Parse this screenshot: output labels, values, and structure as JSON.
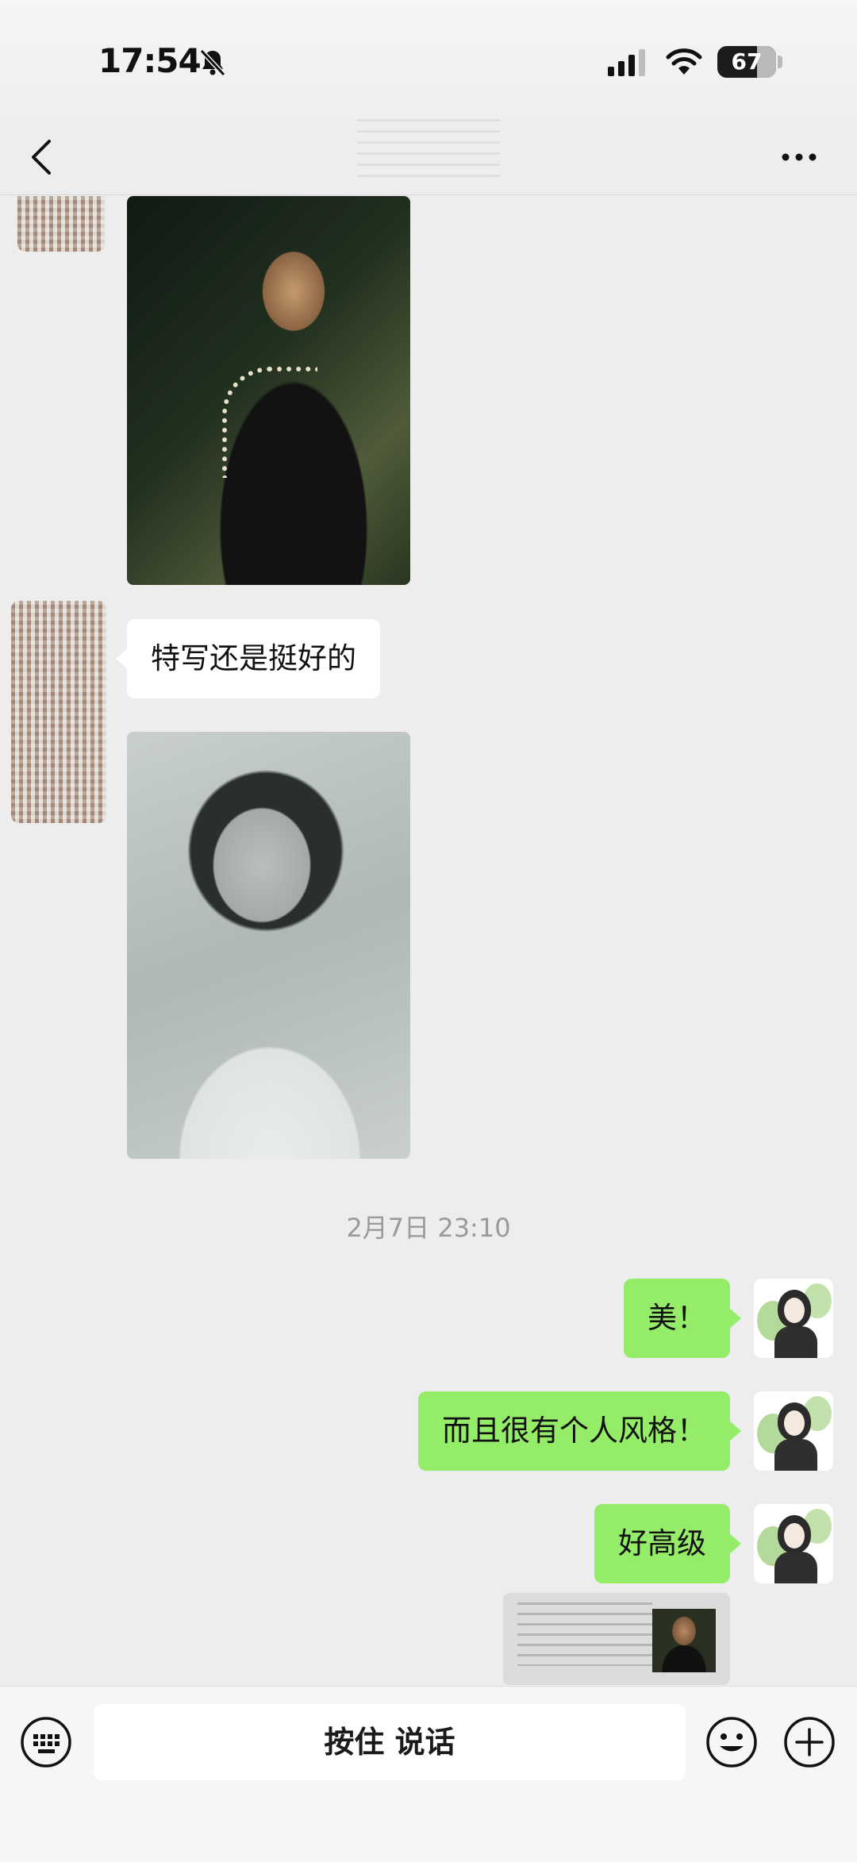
{
  "status_bar": {
    "time": "17:54",
    "battery_level": "67",
    "icons": [
      "bell-slash-icon",
      "signal-icon",
      "wifi-icon",
      "battery-icon"
    ]
  },
  "nav": {
    "back_icon": "chevron-left-icon",
    "more_icon": "ellipsis-icon"
  },
  "messages": [
    {
      "side": "left",
      "type": "image",
      "content": "photo-woman-dark-background"
    },
    {
      "side": "left",
      "type": "text",
      "text": "特写还是挺好的"
    },
    {
      "side": "left",
      "type": "image",
      "content": "photo-woman-grayscale"
    },
    {
      "type": "timestamp",
      "text": "2月7日 23:10"
    },
    {
      "side": "right",
      "type": "text",
      "text": "美！"
    },
    {
      "side": "right",
      "type": "text",
      "text": "而且很有个人风格！"
    },
    {
      "side": "right",
      "type": "text",
      "text": "好高级"
    },
    {
      "side": "right",
      "type": "share-card",
      "content": "shared-article-thumbnail"
    }
  ],
  "input_bar": {
    "voice_toggle_icon": "keyboard-icon",
    "hold_to_talk_label": "按住 说话",
    "emoji_icon": "smiley-icon",
    "plus_icon": "plus-circle-icon"
  },
  "colors": {
    "background": "#ededed",
    "own_bubble": "#95ec69",
    "other_bubble": "#ffffff",
    "timestamp_text": "#9a9a9a"
  }
}
